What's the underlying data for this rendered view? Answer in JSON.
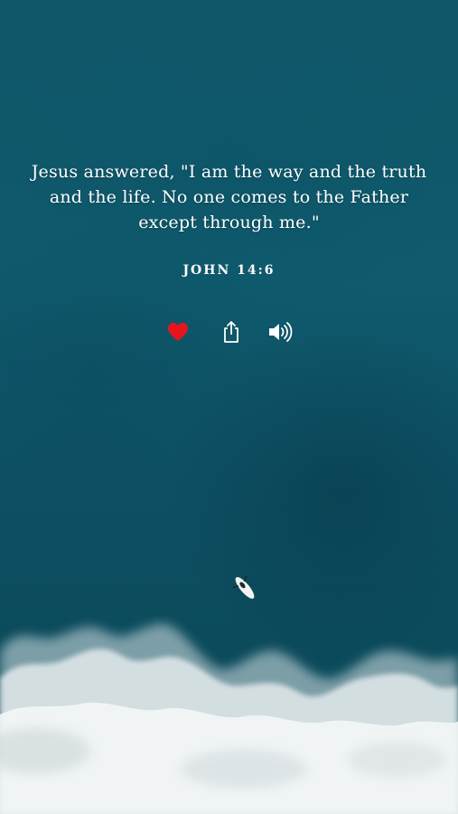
{
  "verse": {
    "text": "Jesus answered, \"I am the way and the truth and the life. No one comes to the Father except through me.\"",
    "reference": "JOHN 14:6"
  },
  "actions": [
    {
      "icon": "heart-icon",
      "state": "liked",
      "color": "#e8141d"
    },
    {
      "icon": "share-icon",
      "color": "#ffffff"
    },
    {
      "icon": "speaker-icon",
      "color": "#ffffff"
    }
  ],
  "colors": {
    "text": "#ffffff",
    "ocean": "#0f5668",
    "foam": "#e6eced"
  }
}
